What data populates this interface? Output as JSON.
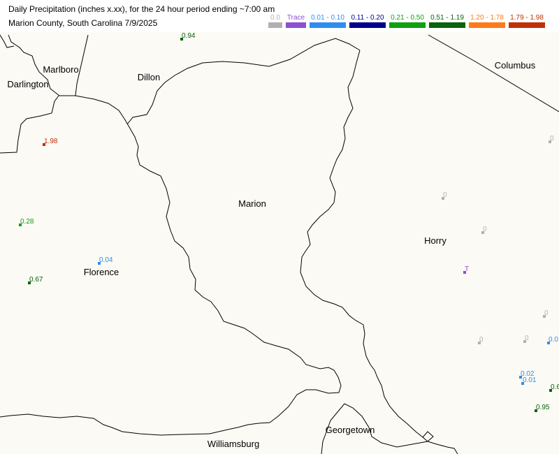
{
  "header": {
    "title_line1": "Daily Precipitation (inches  x.xx),  for the 24 hour period ending ~7:00 am",
    "title_line2": "Marion County, South Carolina  7/9/2025"
  },
  "legend": [
    {
      "label": "0.0",
      "color": "#b0b0b0",
      "width": 20
    },
    {
      "label": "Trace",
      "color": "#8e4fd0",
      "width": 29
    },
    {
      "label": "0.01 - 0.10",
      "color": "#2e8ef0",
      "width": 52
    },
    {
      "label": "0.11 - 0.20",
      "color": "#00008b",
      "width": 52
    },
    {
      "label": "0.21 - 0.50",
      "color": "#0fa00f",
      "width": 52
    },
    {
      "label": "0.51 - 1.19",
      "color": "#0a620a",
      "width": 52
    },
    {
      "label": "1.20 - 1.78",
      "color": "#ff7a1a",
      "width": 52
    },
    {
      "label": "1.79 - 1.98",
      "color": "#c0300a",
      "width": 52
    }
  ],
  "counties": [
    {
      "id": "marlboro",
      "name": "Marlboro"
    },
    {
      "id": "darlington",
      "name": "Darlington"
    },
    {
      "id": "dillon",
      "name": "Dillon"
    },
    {
      "id": "columbus",
      "name": "Columbus"
    },
    {
      "id": "marion",
      "name": "Marion"
    },
    {
      "id": "horry",
      "name": "Horry"
    },
    {
      "id": "florence",
      "name": "Florence"
    },
    {
      "id": "georgetown",
      "name": "Georgetown"
    },
    {
      "id": "williamsburg",
      "name": "Williamsburg"
    }
  ],
  "stations": [
    {
      "value": "0.94",
      "color": "#0a620a"
    },
    {
      "value": "1.98",
      "color": "#c0300a"
    },
    {
      "value": "0.28",
      "color": "#0fa00f"
    },
    {
      "value": "0.04",
      "color": "#2e8ef0"
    },
    {
      "value": "0.67",
      "color": "#0a620a"
    },
    {
      "value": "0",
      "color": "#b0b0b0"
    },
    {
      "value": "0",
      "color": "#b0b0b0"
    },
    {
      "value": "0",
      "color": "#b0b0b0"
    },
    {
      "value": "T",
      "color": "#8e4fd0"
    },
    {
      "value": "0",
      "color": "#b0b0b0"
    },
    {
      "value": "0",
      "color": "#b0b0b0"
    },
    {
      "value": "0",
      "color": "#b0b0b0"
    },
    {
      "value": "0.0",
      "color": "#2e8ef0"
    },
    {
      "value": "0.02",
      "color": "#2e8ef0"
    },
    {
      "value": "0.01",
      "color": "#2e8ef0"
    },
    {
      "value": "0.6",
      "color": "#0a620a"
    },
    {
      "value": "0.95",
      "color": "#0a620a"
    }
  ]
}
